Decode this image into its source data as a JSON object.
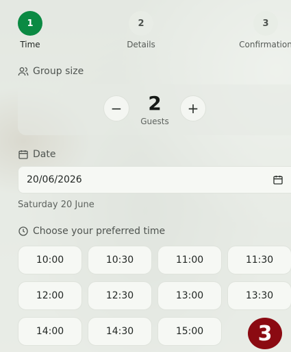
{
  "stepper": {
    "steps": [
      {
        "number": "1",
        "label": "Time",
        "active": true
      },
      {
        "number": "2",
        "label": "Details",
        "active": false
      },
      {
        "number": "3",
        "label": "Confirmation",
        "active": false
      }
    ]
  },
  "group": {
    "title": "Group size",
    "count": "2",
    "unit": "Guests",
    "decrease_label": "−",
    "increase_label": "+"
  },
  "date": {
    "title": "Date",
    "value": "20/06/2026",
    "weekday_label": "Saturday 20 June"
  },
  "time": {
    "title": "Choose your preferred time",
    "slots": [
      "10:00",
      "10:30",
      "11:00",
      "11:30",
      "12:00",
      "12:30",
      "13:00",
      "13:30",
      "14:00",
      "14:30",
      "15:00"
    ]
  },
  "badge": {
    "value": "3"
  },
  "colors": {
    "accent": "#0b8a43",
    "badge": "#8b0a12"
  }
}
